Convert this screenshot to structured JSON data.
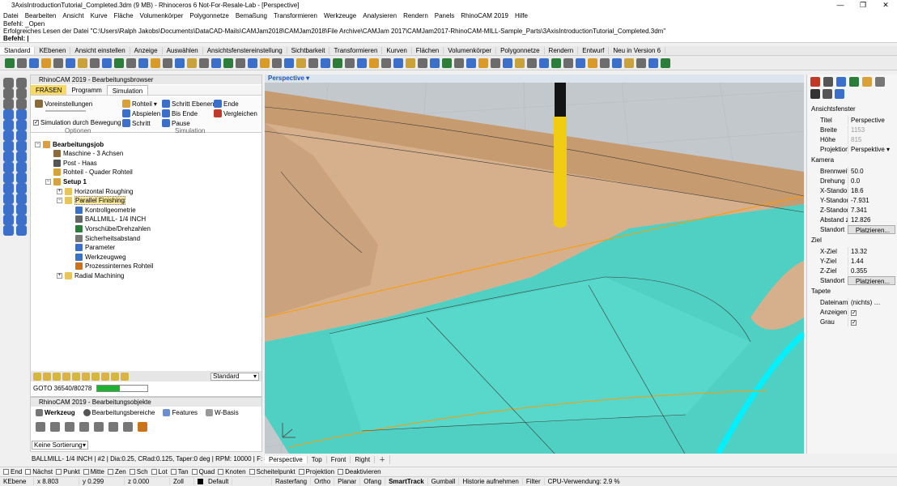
{
  "window": {
    "title": "3AxisIntroductionTutorial_Completed.3dm (9 MB) - Rhinoceros 6 Not-For-Resale-Lab - [Perspective]"
  },
  "menu": [
    "Datei",
    "Bearbeiten",
    "Ansicht",
    "Kurve",
    "Fläche",
    "Volumenkörper",
    "Polygonnetze",
    "Bemaßung",
    "Transformieren",
    "Werkzeuge",
    "Analysieren",
    "Rendern",
    "Panels",
    "RhinoCAM 2019",
    "Hilfe"
  ],
  "command": {
    "line1": "Befehl: _Open",
    "line2": "Erfolgreiches Lesen der Datei \"C:\\Users\\Ralph Jakobs\\Documents\\DataCAD-Mails\\CAMJam2018\\CAMJam2018\\File Archive\\CAMJam 2017\\CAMJam2017-RhinoCAM-MILL-Sample_Parts\\3AxisIntroductionTutorial_Completed.3dm\"",
    "prompt": "Befehl:"
  },
  "toolbar_tabs": [
    "Standard",
    "KEbenen",
    "Ansicht einstellen",
    "Anzeige",
    "Auswählen",
    "Ansichtsfenstereinstellung",
    "Sichtbarkeit",
    "Transformieren",
    "Kurven",
    "Flächen",
    "Volumenkörper",
    "Polygonnetze",
    "Rendern",
    "Entwurf",
    "Neu in Version 6"
  ],
  "machining_browser": {
    "title": "RhinoCAM 2019 - Bearbeitungsbrowser",
    "tabs": {
      "mill": "FRÄSEN",
      "program": "Programm",
      "simulation": "Simulation"
    },
    "ribbon": {
      "settings": "Voreinstellungen",
      "sim_by_motion": "Simulation durch Bewegung",
      "options_group": "Optionen",
      "stock": "Rohteil",
      "play": "Abspielen",
      "step": "Schritt",
      "step_levels": "Schritt Ebenen",
      "to_end": "Bis Ende",
      "pause": "Pause",
      "end": "Ende",
      "compare": "Vergleichen",
      "sim_group": "Simulation"
    },
    "tree": [
      "Bearbeitungsjob",
      "Maschine - 3 Achsen",
      "Post - Haas",
      "Rohteil - Quader Rohteil",
      "Setup 1",
      "Horizontal Roughing",
      "Parallel Finishing",
      "Kontrollgeometrie",
      "BALLMILL- 1/4 INCH",
      "Vorschübe/Drehzahlen",
      "Sicherheitsabstand",
      "Parameter",
      "Werkzeugweg",
      "Prozessinternes Rohteil",
      "Radial Machining"
    ],
    "style_select": "Standard",
    "goto": "GOTO 36540/80278",
    "progress": 0.45
  },
  "machining_objects": {
    "title": "RhinoCAM 2019 - Bearbeitungsobjekte",
    "tools": "Werkzeug",
    "regions": "Bearbeitungsbereiche",
    "features": "Features",
    "wbasis": "W-Basis",
    "sort": "Keine Sortierung"
  },
  "tool_info": "BALLMILL- 1/4 INCH | #2 | Dia:0.25, CRad:0.125, Taper:0 deg | RPM: 10000 | F: 80",
  "viewport": {
    "label": "Perspective",
    "tabs": [
      "Perspective",
      "Top",
      "Front",
      "Right"
    ]
  },
  "properties": {
    "section_view": "Ansichtsfenster",
    "rows_view": [
      [
        "Titel",
        "Perspective"
      ],
      [
        "Breite",
        "1153"
      ],
      [
        "Höhe",
        "815"
      ],
      [
        "Projektion",
        "Perspektive"
      ]
    ],
    "section_camera": "Kamera",
    "rows_camera": [
      [
        "Brennweite",
        "50.0"
      ],
      [
        "Drehung",
        "0.0"
      ],
      [
        "X-Standort",
        "18.6"
      ],
      [
        "Y-Standort",
        "-7.931"
      ],
      [
        "Z-Standort",
        "7.341"
      ],
      [
        "Abstand z...",
        "12.826"
      ],
      [
        "Standort",
        "Platzieren..."
      ]
    ],
    "section_target": "Ziel",
    "rows_target": [
      [
        "X-Ziel",
        "13.32"
      ],
      [
        "Y-Ziel",
        "1.44"
      ],
      [
        "Z-Ziel",
        "0.355"
      ],
      [
        "Standort",
        "Platzieren..."
      ]
    ],
    "section_wallpaper": "Tapete",
    "rows_wallpaper": [
      [
        "Dateiname",
        "(nichts)"
      ],
      [
        "Anzeigen",
        ""
      ],
      [
        "Grau",
        ""
      ]
    ]
  },
  "osnaps": [
    "End",
    "Nächst",
    "Punkt",
    "Mitte",
    "Zen",
    "Sch",
    "Lot",
    "Tan",
    "Quad",
    "Knoten",
    "Scheitelpunkt",
    "Projektion",
    "Deaktivieren"
  ],
  "status": {
    "layer_label": "KEbene",
    "x": "x 8.803",
    "y": "y 0.299",
    "z": "z 0.000",
    "unit": "Zoll",
    "layer": "Default",
    "toggles": [
      "Rasterfang",
      "Ortho",
      "Planar",
      "Ofang",
      "SmartTrack",
      "Gumball",
      "Historie aufnehmen",
      "Filter"
    ],
    "cpu": "CPU-Verwendung: 2.9 %"
  }
}
